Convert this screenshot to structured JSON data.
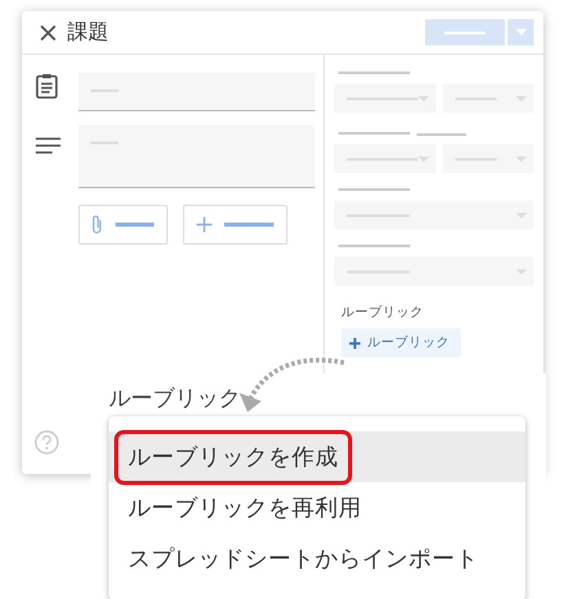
{
  "window": {
    "title": "課題"
  },
  "side_panel": {
    "rubric_label": "ルーブリック",
    "rubric_button": "ルーブリック"
  },
  "callout": {
    "label": "ルーブリック",
    "menu": [
      {
        "label": "ルーブリックを作成",
        "selected": true
      },
      {
        "label": "ルーブリックを再利用",
        "selected": false
      },
      {
        "label": "スプレッドシートからインポート",
        "selected": false
      }
    ]
  }
}
